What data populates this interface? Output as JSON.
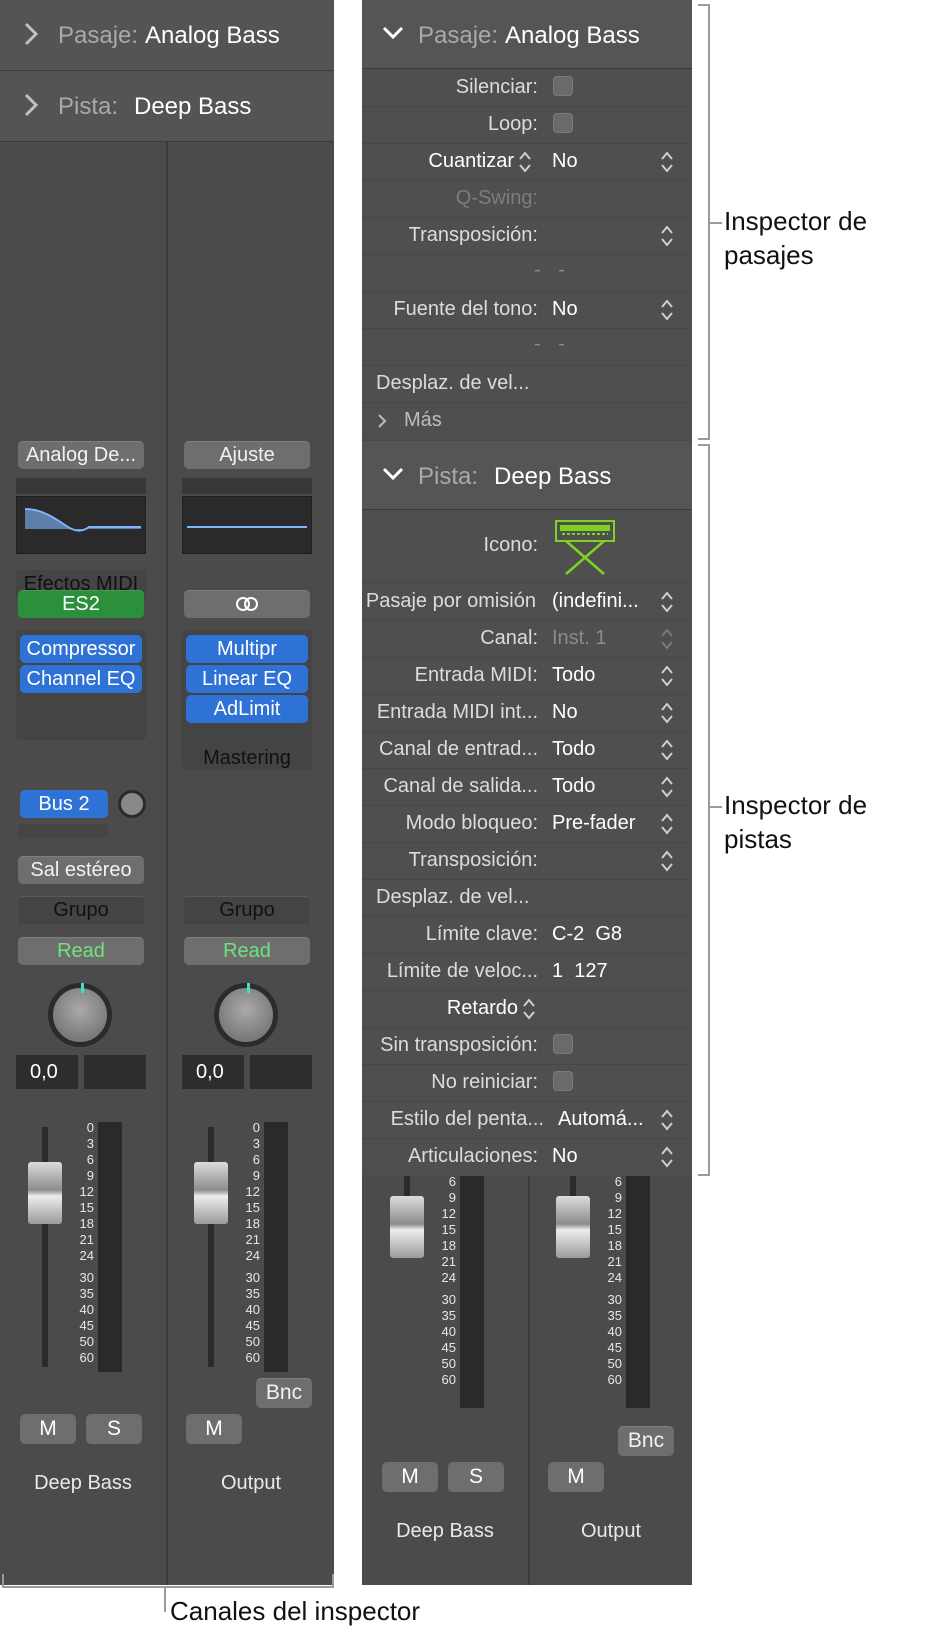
{
  "left": {
    "pasaje_header": {
      "label": "Pasaje:",
      "value": "Analog Bass"
    },
    "pista_header": {
      "label": "Pista:",
      "value": "Deep Bass"
    },
    "strip1": {
      "setting": "Analog De...",
      "midi_fx": "Efectos MIDI",
      "instrument": "ES2",
      "plugins": [
        "Compressor",
        "Channel EQ"
      ],
      "send": "Bus 2",
      "output": "Sal estéreo",
      "group": "Grupo",
      "automation": "Read",
      "volume": "0,0",
      "mute": "M",
      "solo": "S",
      "name": "Deep Bass"
    },
    "strip2": {
      "setting": "Ajuste",
      "link_icon": "link-rings-icon",
      "plugins": [
        "Multipr",
        "Linear EQ",
        "AdLimit"
      ],
      "plugin_label": "Mastering",
      "group": "Grupo",
      "automation": "Read",
      "volume": "0,0",
      "bounce": "Bnc",
      "mute": "M",
      "name": "Output"
    },
    "scale": [
      "0",
      "3",
      "6",
      "9",
      "12",
      "15",
      "18",
      "21",
      "24",
      "30",
      "35",
      "40",
      "45",
      "50",
      "60"
    ]
  },
  "right": {
    "region_header": {
      "label": "Pasaje:",
      "value": "Analog Bass"
    },
    "region_rows": {
      "mute": "Silenciar:",
      "loop": "Loop:",
      "quantize": {
        "key": "Cuantizar",
        "value": "No"
      },
      "qswing": "Q-Swing:",
      "transpose": "Transposición:",
      "dashes": "- -",
      "pitch_source": {
        "key": "Fuente del tono:",
        "value": "No"
      },
      "dashes2": "- -",
      "velocity": "Desplaz. de vel...",
      "more": "Más"
    },
    "track_header": {
      "label": "Pista:",
      "value": "Deep Bass"
    },
    "track_rows": {
      "icon": "Icono:",
      "default_region": {
        "key": "Pasaje por omisión",
        "value": "(indefini..."
      },
      "channel": {
        "key": "Canal:",
        "value": "Inst. 1"
      },
      "midi_in": {
        "key": "Entrada MIDI:",
        "value": "Todo"
      },
      "midi_in_int": {
        "key": "Entrada MIDI int...",
        "value": "No"
      },
      "in_channel": {
        "key": "Canal de entrad...",
        "value": "Todo"
      },
      "out_channel": {
        "key": "Canal de salida...",
        "value": "Todo"
      },
      "freeze": {
        "key": "Modo bloqueo:",
        "value": "Pre-fader"
      },
      "transpose": "Transposición:",
      "velocity": "Desplaz. de vel...",
      "key_limit": {
        "key": "Límite clave:",
        "value": "C-2  G8"
      },
      "vel_limit": {
        "key": "Límite de veloc...",
        "value": "1  127"
      },
      "delay": "Retardo",
      "no_transpose": "Sin transposición:",
      "no_reset": "No reiniciar:",
      "staff_style": {
        "key": "Estilo del penta...",
        "value": "Automá..."
      },
      "articulations": {
        "key": "Articulaciones:",
        "value": "No"
      }
    },
    "strip1": {
      "mute": "M",
      "solo": "S",
      "name": "Deep Bass"
    },
    "strip2": {
      "bounce": "Bnc",
      "mute": "M",
      "name": "Output"
    }
  },
  "annotations": {
    "region": [
      "Inspector de",
      "pasajes"
    ],
    "track": [
      "Inspector de",
      "pistas"
    ],
    "channels": "Canales del inspector"
  },
  "colors": {
    "panel": "#4b4b4b",
    "plugin_blue": "#2f72d6",
    "instrument_green": "#2b8f3b",
    "read_green": "#6fe37a",
    "keyboard_icon": "#7ed321"
  }
}
